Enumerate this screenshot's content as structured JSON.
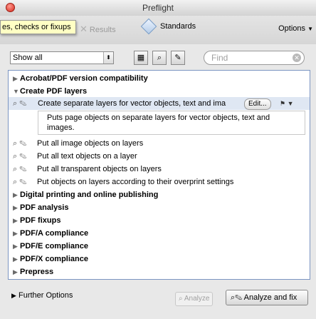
{
  "window": {
    "title": "Preflight"
  },
  "toolbar": {
    "tooltip": "es, checks or fixups",
    "results_label": "Results",
    "standards_label": "Standards",
    "options_label": "Options"
  },
  "filter": {
    "select_value": "Show all",
    "find_placeholder": "Find"
  },
  "tree": {
    "categories_top": [
      {
        "label": "Acrobat/PDF version compatibility",
        "expanded": false
      },
      {
        "label": "Create PDF layers",
        "expanded": true
      }
    ],
    "selected_item": {
      "label": "Create separate layers for vector objects, text and ima",
      "edit_label": "Edit...",
      "description": "Puts page objects on separate layers for vector objects, text and images."
    },
    "items": [
      "Put all image objects on layers",
      "Put all text objects on a layer",
      "Put all transparent objects on layers",
      "Put objects on layers according to their overprint settings"
    ],
    "categories_bottom": [
      "Digital printing and online publishing",
      "PDF analysis",
      "PDF fixups",
      "PDF/A compliance",
      "PDF/E compliance",
      "PDF/X compliance",
      "Prepress"
    ]
  },
  "footer": {
    "further_options": "Further Options",
    "analyze_label": "Analyze",
    "analyze_fix_label": "Analyze and fix"
  }
}
